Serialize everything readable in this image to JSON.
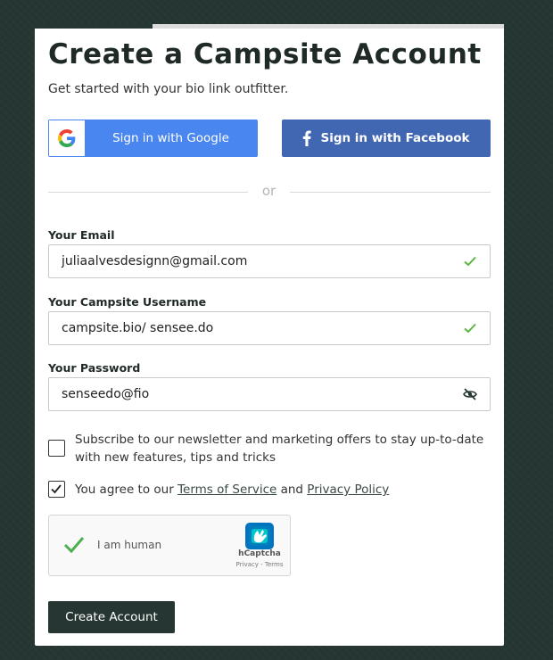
{
  "progress_fraction": 0.25,
  "header": {
    "title": "Create a Campsite Account",
    "subtitle": "Get started with your bio link outfitter."
  },
  "social": {
    "google_label": "Sign in with Google",
    "facebook_label": "Sign in with Facebook"
  },
  "divider_text": "or",
  "form": {
    "email": {
      "label": "Your Email",
      "value": "juliaalvesdesignn@gmail.com",
      "status_icon": "check-icon"
    },
    "username": {
      "label": "Your Campsite Username",
      "value": "campsite.bio/ sensee.do",
      "status_icon": "check-icon"
    },
    "password": {
      "label": "Your Password",
      "value": "senseedo@fio",
      "toggle_icon": "eye-slash-icon"
    }
  },
  "checkboxes": {
    "newsletter": {
      "checked": false,
      "line1": "Subscribe to our newsletter and marketing offers to stay up-to-date",
      "line2": "with new features, tips and tricks"
    },
    "terms": {
      "checked": true,
      "prefix": "You agree to our ",
      "terms_link": "Terms of Service",
      "and": " and ",
      "privacy_link": "Privacy Policy"
    }
  },
  "captcha": {
    "label": "I am human",
    "brand": "hCaptcha",
    "links": "Privacy - Terms"
  },
  "submit_label": "Create Account",
  "colors": {
    "background": "#263632",
    "primary_dark": "#263632",
    "google_blue": "#4a86f0",
    "facebook_blue": "#4267b2",
    "check_green": "#5bb543"
  }
}
